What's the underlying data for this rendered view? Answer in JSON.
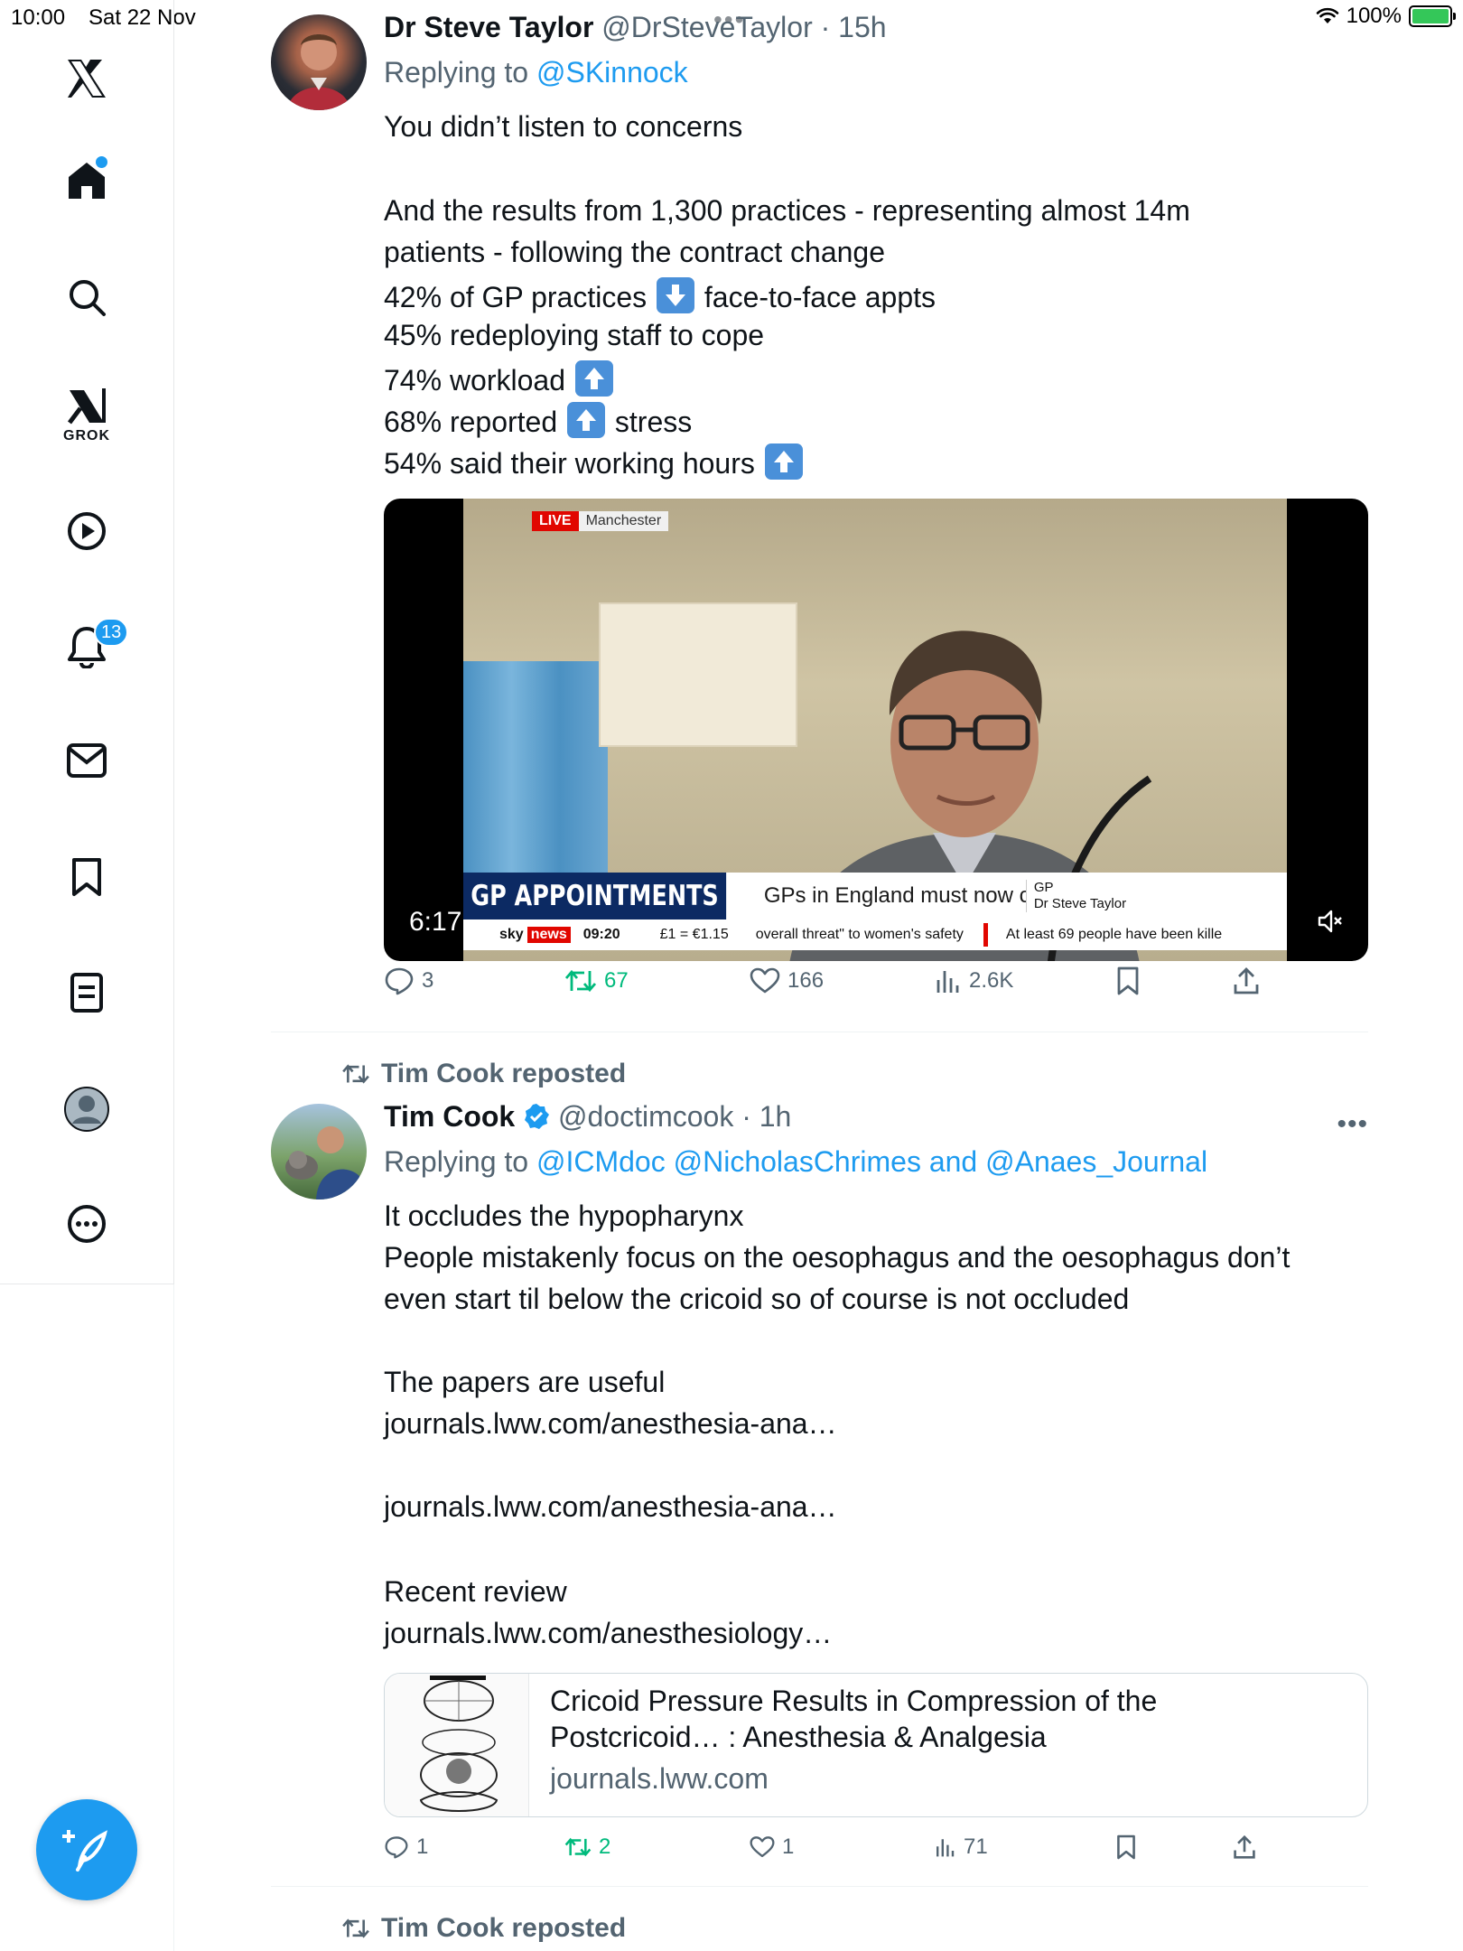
{
  "status_bar": {
    "time": "10:00",
    "date": "Sat 22 Nov",
    "battery": "100%",
    "battery_color": "#34c759"
  },
  "sidebar": {
    "items": [
      {
        "name": "x-logo-icon"
      },
      {
        "name": "home-icon",
        "has_dot": true
      },
      {
        "name": "search-icon"
      },
      {
        "name": "grok-icon",
        "label": "GROK"
      },
      {
        "name": "video-icon"
      },
      {
        "name": "notifications-icon",
        "badge": "13"
      },
      {
        "name": "messages-icon"
      },
      {
        "name": "bookmarks-icon"
      },
      {
        "name": "lists-icon"
      },
      {
        "name": "profile-icon"
      },
      {
        "name": "more-icon"
      }
    ],
    "compose_icon": "compose-icon",
    "accent": "#1d9bf0"
  },
  "tweet1": {
    "name": "Dr Steve Taylor",
    "handle": "@DrSteveTaylor",
    "sep": "·",
    "time": "15h",
    "replying_prefix": "Replying to",
    "replying_to": "@SKinnock",
    "lines": {
      "l1": "You didn’t listen to concerns",
      "l2": "And the results from 1,300 practices - representing almost 14m",
      "l3": "patients - following the contract change",
      "l4a": "42% of GP practices",
      "l4b": "face-to-face appts",
      "l5": "45% redeploying staff to cope",
      "l6": "74% workload",
      "l7a": "68% reported",
      "l7b": "stress",
      "l8": "54% said their working hours"
    },
    "video": {
      "live": "LIVE",
      "location": "Manchester",
      "headline": "GP APPOINTMENTS",
      "ticker_text": "GPs in England must now c",
      "guest_role": "GP",
      "guest_name": "Dr Steve Taylor",
      "brand_sky": "sky",
      "brand_news": "news",
      "clock": "09:20",
      "fx": "£1 = €1.15",
      "ticker_a": "overall threat\" to women's safety",
      "ticker_b": "At least 69 people have been kille",
      "duration": "6:17",
      "mute_icon": "mute-icon"
    },
    "stats": {
      "replies": "3",
      "reposts": "67",
      "likes": "166",
      "views": "2.6K"
    }
  },
  "tweet2": {
    "repost_label": "Tim Cook reposted",
    "name": "Tim Cook",
    "verified_color": "#1d9bf0",
    "handle": "@doctimcook",
    "sep": "·",
    "time": "1h",
    "replying_prefix": "Replying to",
    "replying_to": "@ICMdoc @NicholasChrimes and @Anaes_Journal",
    "lines": {
      "l1": "It occludes the hypopharynx",
      "l2": "People mistakenly focus on the oesophagus and the oesophagus don’t",
      "l3": "even start til below the cricoid so of course is not occluded",
      "l4": "The papers are useful",
      "link1": "journals.lww.com/anesthesia-ana…",
      "link2": "journals.lww.com/anesthesia-ana…",
      "l5": "Recent review",
      "link3": "journals.lww.com/anesthesiology…"
    },
    "card": {
      "title_1": "Cricoid Pressure Results in Compression of the",
      "title_2": "Postcricoid… : Anesthesia & Analgesia",
      "domain": "journals.lww.com"
    },
    "stats": {
      "replies": "1",
      "reposts": "2",
      "likes": "1",
      "views": "71"
    }
  },
  "tweet3": {
    "repost_label": "Tim Cook reposted"
  },
  "colors": {
    "repost_green": "#00ba7c",
    "link_blue": "#1d9bf0",
    "muted_gray": "#536471"
  }
}
